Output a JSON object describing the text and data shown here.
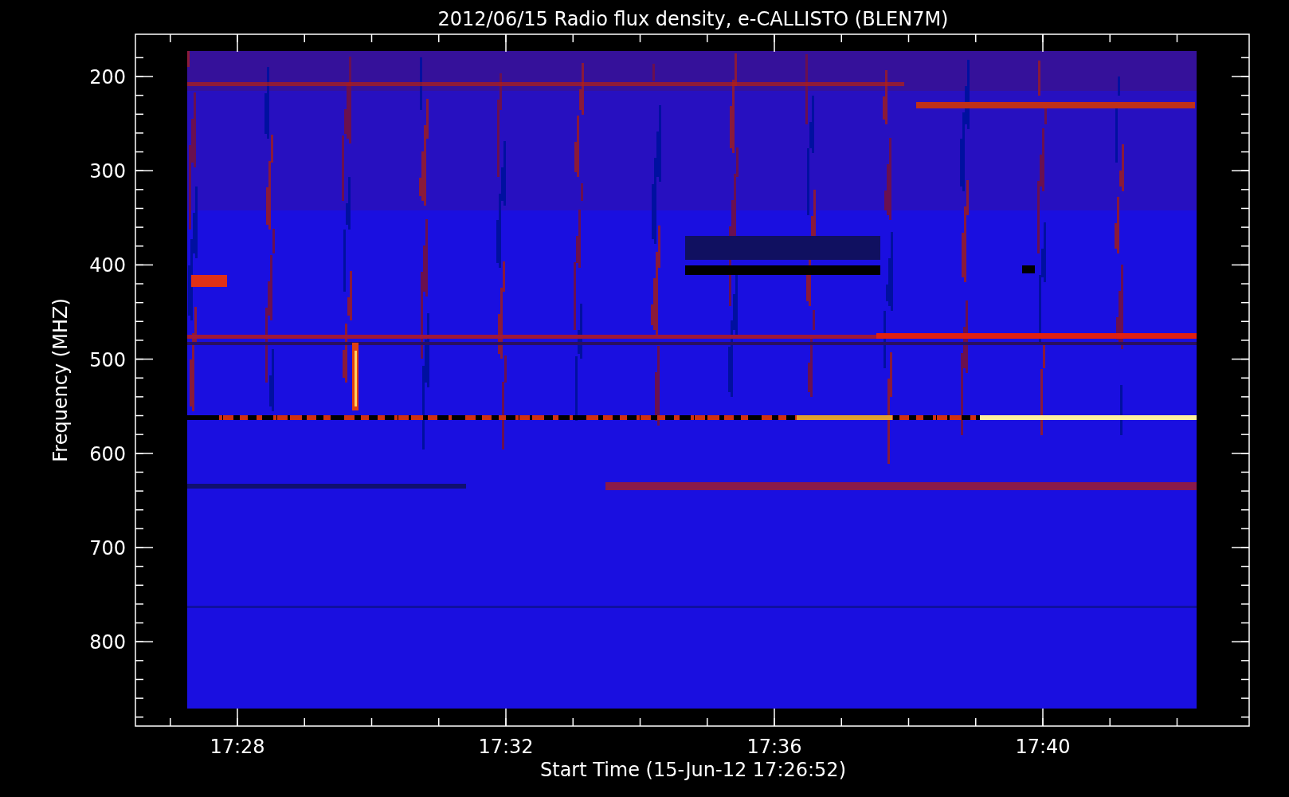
{
  "title": "2012/06/15  Radio flux density, e-CALLISTO (BLEN7M)",
  "y_axis": {
    "label": "Frequency (MHZ)",
    "ticks": [
      "200",
      "300",
      "400",
      "500",
      "600",
      "700",
      "800"
    ]
  },
  "x_axis": {
    "label": "Start Time (15-Jun-12 17:26:52)",
    "ticks": [
      "17:28",
      "17:32",
      "17:36",
      "17:40"
    ]
  }
}
